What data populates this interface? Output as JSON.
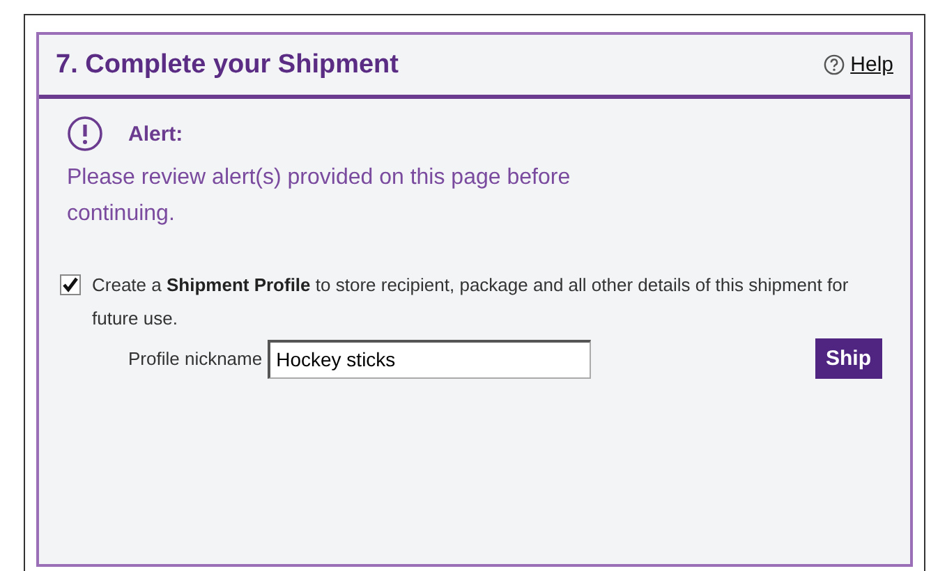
{
  "panel": {
    "title": "7. Complete your Shipment",
    "help_link": "Help"
  },
  "alert": {
    "heading": "Alert:",
    "message": "Please review alert(s) provided on this page before continuing."
  },
  "profile_option": {
    "checked": true,
    "text": "Create a **Shipment Profile** to store recipient, package and all other details of this shipment for future use."
  },
  "nickname": {
    "label": "Profile nickname",
    "value": "Hockey sticks"
  },
  "buttons": [
    "Ship"
  ]
}
